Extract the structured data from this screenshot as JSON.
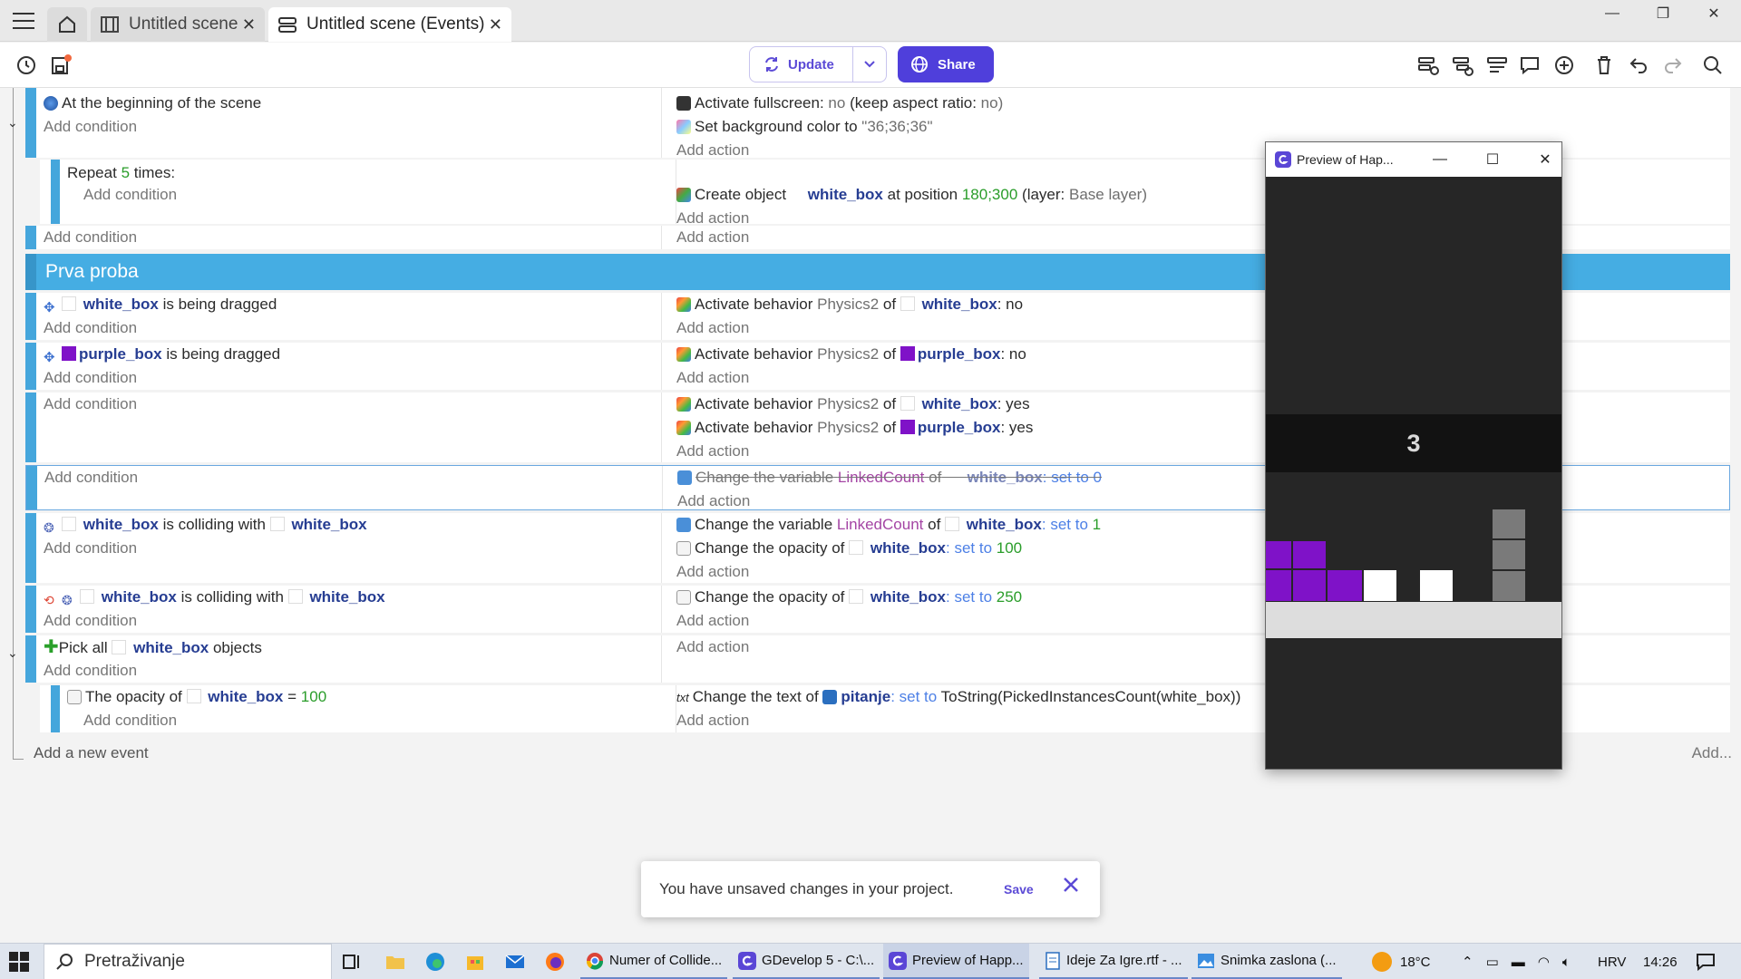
{
  "window": {
    "tabs": [
      {
        "label": "Untitled scene"
      },
      {
        "label": "Untitled scene (Events)"
      }
    ]
  },
  "toolbar": {
    "update_label": "Update",
    "share_label": "Share"
  },
  "events": {
    "e1": {
      "condition": "At the beginning of the scene",
      "add_condition": "Add condition",
      "action1_a": "Activate fullscreen:",
      "action1_b": "no",
      "action1_c": "(keep aspect ratio:",
      "action1_d": "no)",
      "action2_a": "Set background color to",
      "action2_b": "\"36;36;36\"",
      "add_action": "Add action"
    },
    "e2": {
      "repeat_a": "Repeat",
      "repeat_n": "5",
      "repeat_b": "times:",
      "add_condition": "Add condition",
      "action_a": "Create object",
      "action_obj": "white_box",
      "action_b": "at position",
      "action_pos": "180;300",
      "action_c": "(layer:",
      "action_layer": "Base layer)",
      "add_action": "Add action"
    },
    "e3": {
      "add_condition": "Add condition",
      "add_action": "Add action"
    },
    "group": {
      "title": "Prva proba"
    },
    "e4": {
      "obj": "white_box",
      "cond": "is being dragged",
      "add_condition": "Add condition",
      "act_a": "Activate behavior",
      "act_beh": "Physics2",
      "act_of": "of",
      "act_obj": "white_box",
      "act_val": ": no",
      "add_action": "Add action"
    },
    "e5": {
      "obj": "purple_box",
      "cond": "is being dragged",
      "add_condition": "Add condition",
      "act_a": "Activate behavior",
      "act_beh": "Physics2",
      "act_of": "of",
      "act_obj": "purple_box",
      "act_val": ": no",
      "add_action": "Add action"
    },
    "e6": {
      "add_condition": "Add condition",
      "act1_a": "Activate behavior",
      "act1_beh": "Physics2",
      "act1_of": "of",
      "act1_obj": "white_box",
      "act1_val": ": yes",
      "act2_a": "Activate behavior",
      "act2_beh": "Physics2",
      "act2_of": "of",
      "act2_obj": "purple_box",
      "act2_val": ": yes",
      "add_action": "Add action"
    },
    "e7": {
      "add_condition": "Add condition",
      "act_a": "Change the variable",
      "act_var": "LinkedCount",
      "act_of": "of",
      "act_obj": "white_box",
      "act_set": ": set to 0",
      "add_action": "Add action"
    },
    "e8": {
      "obj1": "white_box",
      "cond": "is colliding with",
      "obj2": "white_box",
      "add_condition": "Add condition",
      "act1_a": "Change the variable",
      "act1_var": "LinkedCount",
      "act1_of": "of",
      "act1_obj": "white_box",
      "act1_set": ": set to",
      "act1_val": "1",
      "act2_a": "Change the opacity of",
      "act2_obj": "white_box",
      "act2_set": ": set to",
      "act2_val": "100",
      "add_action": "Add action"
    },
    "e9": {
      "obj1": "white_box",
      "cond": "is colliding with",
      "obj2": "white_box",
      "add_condition": "Add condition",
      "act_a": "Change the opacity of",
      "act_obj": "white_box",
      "act_set": ": set to",
      "act_val": "250",
      "add_action": "Add action"
    },
    "e10": {
      "cond_a": "Pick all",
      "obj": "white_box",
      "cond_b": "objects",
      "add_condition": "Add condition",
      "add_action": "Add action"
    },
    "e11": {
      "cond_a": "The opacity of",
      "obj": "white_box",
      "cond_eq": "=",
      "cond_val": "100",
      "add_condition": "Add condition",
      "act_a": "Change the text of",
      "act_obj": "pitanje",
      "act_set": ": set to",
      "act_expr": "ToString(PickedInstancesCount(white_box))",
      "add_action": "Add action"
    },
    "add_event": "Add a new event",
    "add_more": "Add..."
  },
  "preview": {
    "title": "Preview of Hap...",
    "score": "3"
  },
  "snackbar": {
    "message": "You have unsaved changes in your project.",
    "save_label": "Save"
  },
  "taskbar": {
    "search_placeholder": "Pretraživanje",
    "tasks": [
      {
        "label": "Numer of Collide..."
      },
      {
        "label": "GDevelop 5 - C:\\..."
      },
      {
        "label": "Preview of Happ..."
      },
      {
        "label": "Ideje Za Igre.rtf - ..."
      },
      {
        "label": "Snimka zaslona (..."
      }
    ],
    "weather": "18°C",
    "lang": "HRV",
    "time": "14:26"
  },
  "colors": {
    "accent": "#4f3fdb",
    "group_blue": "#45ade3",
    "purple_box": "#7f12c8"
  }
}
